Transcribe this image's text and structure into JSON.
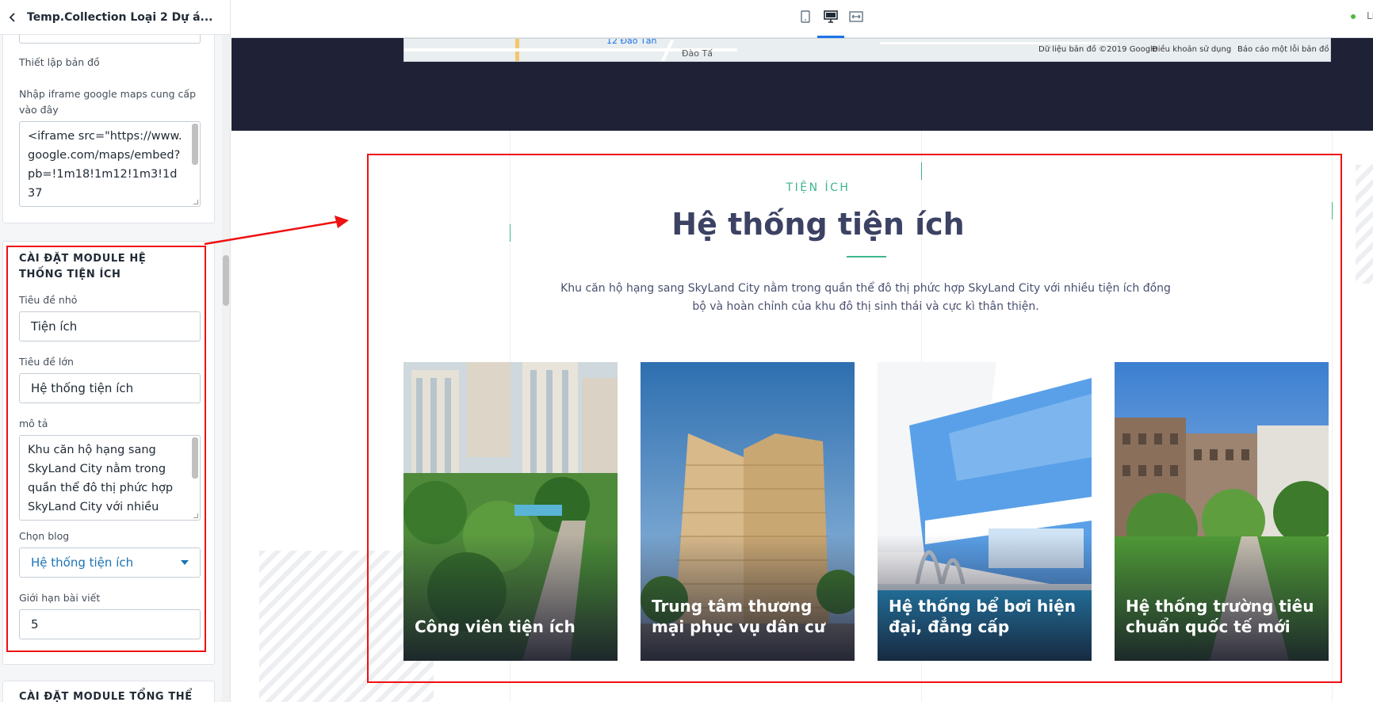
{
  "sidebar": {
    "title": "Temp.Collection Loại 2 Dự á...",
    "map_section": {
      "heading": "Thiết lập bản đồ",
      "iframe_label": "Nhập iframe google maps cung cấp vào đây",
      "iframe_value": "<iframe src=\"https://www.google.com/maps/embed?pb=!1m18!1m12!1m3!1d37"
    },
    "amenities_section": {
      "heading": "CÀI ĐẶT MODULE HỆ THỐNG TIỆN ÍCH",
      "small_title_label": "Tiêu đề nhỏ",
      "small_title_value": "Tiện ích",
      "big_title_label": "Tiêu đề lớn",
      "big_title_value": "Hệ thống tiện ích",
      "description_label": "mô tả",
      "description_value": "Khu căn hộ hạng sang SkyLand City nằm trong quần thể đô thị phức hợp SkyLand City với nhiều tiện",
      "blog_label": "Chọn blog",
      "blog_value": "Hệ thống tiện ích",
      "limit_label": "Giới hạn bài viết",
      "limit_value": "5"
    },
    "next_section": {
      "heading": "CÀI ĐẶT MODULE TỔNG THỂ DỰ"
    }
  },
  "toolbar": {
    "devices": [
      {
        "name": "mobile",
        "icon": "mobile-icon"
      },
      {
        "name": "desktop",
        "icon": "desktop-icon",
        "active": true
      },
      {
        "name": "fullwidth",
        "icon": "expand-icon"
      }
    ],
    "live_label": "Li"
  },
  "map": {
    "place_label": "12 Đào Tấn",
    "street_label": "Đào Tấ",
    "attribution": "Dữ liệu bản đồ ©2019 Google",
    "terms": "Điều khoản sử dụng",
    "report": "Báo cáo một lỗi bản đồ"
  },
  "section": {
    "small_title": "TIỆN ÍCH",
    "big_title": "Hệ thống tiện ích",
    "description": "Khu căn hộ hạng sang SkyLand City nằm trong quần thể đô thị phức hợp SkyLand City với nhiều tiện ích đồng bộ và hoàn chỉnh của khu đô thị sinh thái và cực kì thân thiện.",
    "cards": [
      {
        "caption": "Công viên tiện ích"
      },
      {
        "caption": "Trung tâm thương mại phục vụ dân cư"
      },
      {
        "caption": "Hệ thống bể bơi hiện đại, đẳng cấp"
      },
      {
        "caption": "Hệ thống trường tiêu chuẩn quốc tế mới"
      }
    ]
  },
  "colors": {
    "accent_green": "#3fb58a",
    "title_navy": "#3c4263",
    "annotation_red": "#e11111",
    "link_blue": "#1a73b5"
  }
}
